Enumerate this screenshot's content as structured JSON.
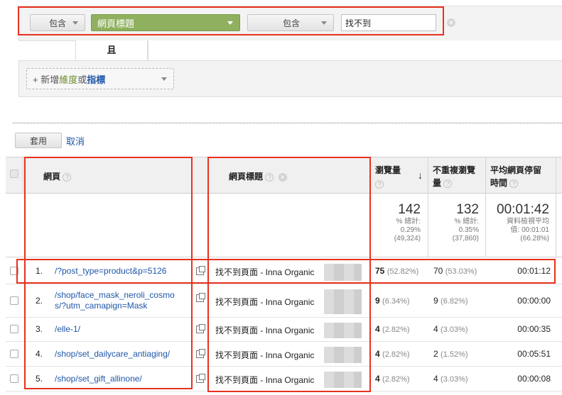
{
  "filter": {
    "include1": "包含",
    "dimension": "網頁標題",
    "include2": "包含",
    "query": "找不到",
    "remove_symbol": "✕"
  },
  "and_label": "且",
  "add_dimension": {
    "prefix": "+ 新增",
    "dim": "維度",
    "or": "或",
    "metric": "指標"
  },
  "actions": {
    "apply": "套用",
    "cancel": "取消"
  },
  "table": {
    "headers": {
      "page": "網頁",
      "page_title": "網頁標題",
      "pageviews": "瀏覽量",
      "unique_pageviews_l1": "不重複瀏覽",
      "unique_pageviews_l2": "量",
      "avg_time_l1": "平均網頁停留",
      "avg_time_l2": "時間",
      "help": "?",
      "sort_arrow": "↓"
    },
    "totals": {
      "pageviews": "142",
      "pageviews_pct_label": "% 總計:",
      "pageviews_pct": "0.29%",
      "pageviews_all": "(49,324)",
      "unique": "132",
      "unique_pct_label": "% 總計:",
      "unique_pct": "0.35%",
      "unique_all": "(37,860)",
      "avg_time": "00:01:42",
      "avg_label_1": "資料檢視平均",
      "avg_label_2": "值: 00:01:01",
      "avg_diff": "(66.28%)"
    },
    "rows": [
      {
        "index": "1.",
        "page": "/?post_type=product&p=5126",
        "page_l2": "",
        "title": "找不到頁面 - Inna Organic",
        "pv": "75",
        "pv_pct": "(52.82%)",
        "upv": "70",
        "upv_pct": "(53.03%)",
        "time": "00:01:12"
      },
      {
        "index": "2.",
        "page": "/shop/face_mask_neroli_cosmo",
        "page_l2": "s/?utm_camapign=Mask",
        "title": "找不到頁面 - Inna Organic",
        "pv": "9",
        "pv_pct": "(6.34%)",
        "upv": "9",
        "upv_pct": "(6.82%)",
        "time": "00:00:00"
      },
      {
        "index": "3.",
        "page": "/elle-1/",
        "page_l2": "",
        "title": "找不到頁面 - Inna Organic",
        "pv": "4",
        "pv_pct": "(2.82%)",
        "upv": "4",
        "upv_pct": "(3.03%)",
        "time": "00:00:35"
      },
      {
        "index": "4.",
        "page": "/shop/set_dailycare_antiaging/",
        "page_l2": "",
        "title": "找不到頁面 - Inna Organic",
        "pv": "4",
        "pv_pct": "(2.82%)",
        "upv": "2",
        "upv_pct": "(1.52%)",
        "time": "00:05:51"
      },
      {
        "index": "5.",
        "page": "/shop/set_gift_allinone/",
        "page_l2": "",
        "title": "找不到頁面 - Inna Organic",
        "pv": "4",
        "pv_pct": "(2.82%)",
        "upv": "4",
        "upv_pct": "(3.03%)",
        "time": "00:00:08"
      }
    ]
  },
  "colors": {
    "highlight": "#e8321f",
    "link": "#1f56a8",
    "dimension_green": "#8fb05e"
  },
  "icons": [
    "help-icon",
    "remove-icon",
    "open-external-icon",
    "sort-desc-icon",
    "dropdown-caret-icon"
  ]
}
